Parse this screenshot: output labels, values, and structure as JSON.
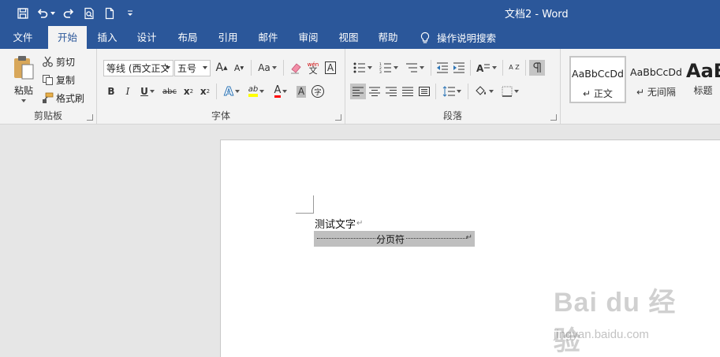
{
  "window": {
    "title": "文档2  -  Word"
  },
  "qat": {
    "icons": [
      "save-icon",
      "undo-icon",
      "redo-icon",
      "print-preview-icon",
      "new-doc-icon",
      "customize-icon"
    ]
  },
  "tabs": [
    {
      "label": "文件"
    },
    {
      "label": "开始"
    },
    {
      "label": "插入"
    },
    {
      "label": "设计"
    },
    {
      "label": "布局"
    },
    {
      "label": "引用"
    },
    {
      "label": "邮件"
    },
    {
      "label": "审阅"
    },
    {
      "label": "视图"
    },
    {
      "label": "帮助"
    }
  ],
  "tell_me": "操作说明搜索",
  "clipboard": {
    "paste": "粘贴",
    "cut": "剪切",
    "copy": "复制",
    "format_painter": "格式刷",
    "group_label": "剪贴板"
  },
  "font": {
    "font_name": "等线 (西文正文",
    "font_size": "五号",
    "grow": "A",
    "shrink": "A",
    "case": "Aa",
    "phonetic_top": "wén",
    "phonetic_bottom": "文",
    "border_char": "A",
    "bold": "B",
    "italic": "I",
    "underline": "U",
    "strike": "abc",
    "subscript": "x",
    "superscript": "x",
    "sub_digit": "2",
    "sup_digit": "2",
    "effects": "A",
    "highlight": "ab",
    "font_color": "A",
    "shading": "A",
    "enclose": "字",
    "group_label": "字体"
  },
  "paragraph": {
    "group_label": "段落",
    "sort": "A Z"
  },
  "styles": [
    {
      "sample": "AaBbCcDd",
      "name": "正文"
    },
    {
      "sample": "AaBbCcDd",
      "name": "无间隔"
    },
    {
      "sample": "AaB",
      "name": "标题"
    }
  ],
  "document": {
    "text": "测试文字",
    "paragraph_mark": "↵",
    "page_break": "分页符"
  },
  "watermark": {
    "logo": "Bai du 经验",
    "url": "jingyan.baidu.com"
  },
  "colors": {
    "brand": "#2b579a",
    "highlight": "#ffff00",
    "font_color": "#ff0000",
    "page_break_bg": "#bfbfbf"
  }
}
